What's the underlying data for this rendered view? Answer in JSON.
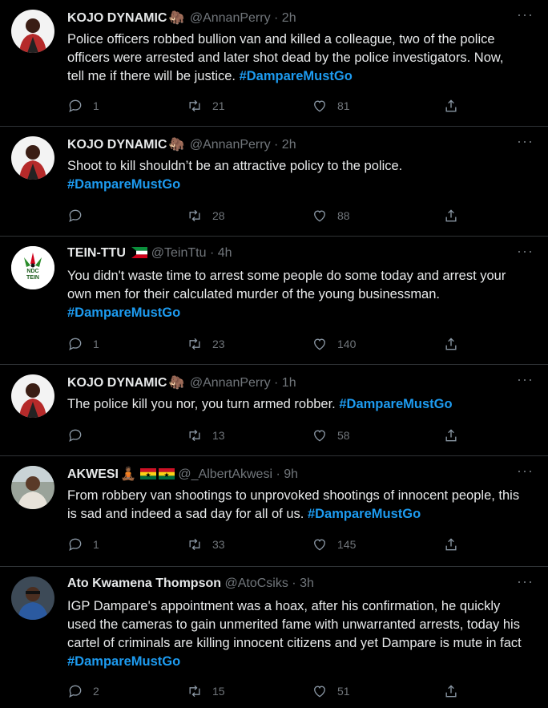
{
  "tweets": [
    {
      "name": "KOJO DYNAMIC",
      "emoji": "🦣",
      "handle": "@AnnanPerry",
      "dot": "·",
      "time": "2h",
      "avatar": "avatar-kojo",
      "text": "Police officers robbed bullion van and killed a colleague, two of the police officers were arrested and later shot dead by the police investigators. Now, tell me if there will be justice.",
      "hashtag": "#DampareMustGo",
      "replies": "1",
      "retweets": "21",
      "likes": "81"
    },
    {
      "name": "KOJO DYNAMIC",
      "emoji": "🦣",
      "handle": "@AnnanPerry",
      "dot": "·",
      "time": "2h",
      "avatar": "avatar-kojo",
      "text": "Shoot to kill shouldn’t be an attractive policy to the police.",
      "hashtag": "#DampareMustGo",
      "replies": "",
      "retweets": "28",
      "likes": "88"
    },
    {
      "name": "TEIN-TTU",
      "emoji": "",
      "handle": "@TeinTtu",
      "dot": "·",
      "time": "4h",
      "avatar": "avatar-tein",
      "avatar_text": "NDC TEIN",
      "text": "You didn't waste time to arrest some people do some today and arrest your own men for their calculated murder of the young businessman.",
      "hashtag": "#DampareMustGo",
      "replies": "1",
      "retweets": "23",
      "likes": "140"
    },
    {
      "name": "KOJO DYNAMIC",
      "emoji": "🦣",
      "handle": "@AnnanPerry",
      "dot": "·",
      "time": "1h",
      "avatar": "avatar-kojo",
      "text": "The police kill you nor, you turn armed robber.",
      "hashtag": "#DampareMustGo",
      "replies": "",
      "retweets": "13",
      "likes": "58"
    },
    {
      "name": "AKWESI",
      "emoji": "🧘🏾",
      "handle": "@_AlbertAkwesi",
      "dot": "·",
      "time": "9h",
      "avatar": "avatar-akwesi",
      "text": "From robbery van shootings to unprovoked shootings of innocent people, this is sad and indeed a sad day for all of us.",
      "hashtag": "#DampareMustGo",
      "replies": "1",
      "retweets": "33",
      "likes": "145"
    },
    {
      "name": "Ato Kwamena Thompson",
      "emoji": "",
      "handle": "@AtoCsiks",
      "dot": "·",
      "time": "3h",
      "avatar": "avatar-ato",
      "text": "IGP Dampare's appointment was a hoax, after his confirmation, he quickly used the cameras to gain unmerited fame with unwarranted arrests, today his cartel of criminals are killing innocent citizens and yet Dampare is mute in fact",
      "hashtag": "#DampareMustGo",
      "replies": "2",
      "retweets": "15",
      "likes": "51"
    }
  ],
  "more_label": "···",
  "colors": {
    "background": "#000000",
    "accent": "#1d9bf0",
    "muted": "#71767b",
    "divider": "#2f3336"
  }
}
